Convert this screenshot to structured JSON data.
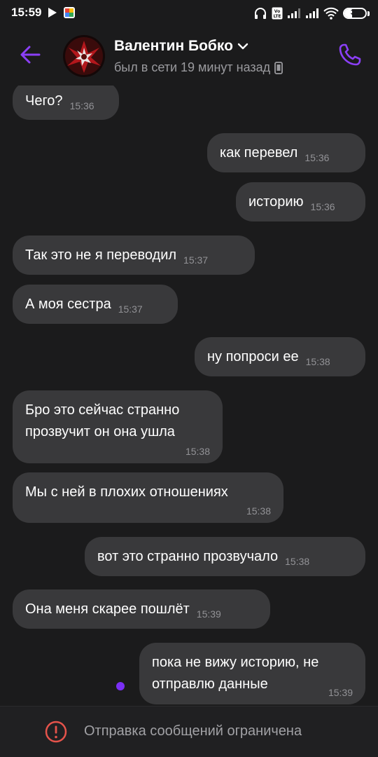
{
  "status_bar": {
    "time": "15:59",
    "battery": "37",
    "battery_level": 0.37,
    "icons": [
      "play-icon",
      "photos-app-icon",
      "headphones-icon",
      "volte-icon",
      "signal-icon",
      "signal-icon",
      "wifi-icon",
      "battery-icon"
    ]
  },
  "header": {
    "contact_name": "Валентин Бобко",
    "last_seen": "был в сети 19 минут назад",
    "accent_color": "#8b3ff7"
  },
  "messages": [
    {
      "direction": "in",
      "text": "Чего?",
      "time": "15:36"
    },
    {
      "direction": "out",
      "text": "как перевел",
      "time": "15:36"
    },
    {
      "direction": "out",
      "text": "историю",
      "time": "15:36"
    },
    {
      "direction": "in",
      "text": "Так это не я переводил",
      "time": "15:37"
    },
    {
      "direction": "in",
      "text": "А моя сестра",
      "time": "15:37"
    },
    {
      "direction": "out",
      "text": "ну попроси ее",
      "time": "15:38"
    },
    {
      "direction": "in",
      "text": "Бро это сейчас странно\nпрозвучит он она ушла",
      "time": "15:38"
    },
    {
      "direction": "in",
      "text": "Мы с ней в плохих отношениях",
      "time": "15:38"
    },
    {
      "direction": "out",
      "text": "вот это странно прозвучало",
      "time": "15:38"
    },
    {
      "direction": "in",
      "text": "Она меня скарее пошлёт",
      "time": "15:39"
    },
    {
      "direction": "out",
      "text": "пока не вижу историю, не\nотправлю данные",
      "time": "15:39"
    }
  ],
  "bottom_bar": {
    "restricted_text": "Отправка сообщений ограничена",
    "restricted_color": "#e5534b"
  },
  "colors": {
    "background": "#1b1b1c",
    "bubble": "#39393b",
    "unread_dot": "#7a2ff5"
  }
}
